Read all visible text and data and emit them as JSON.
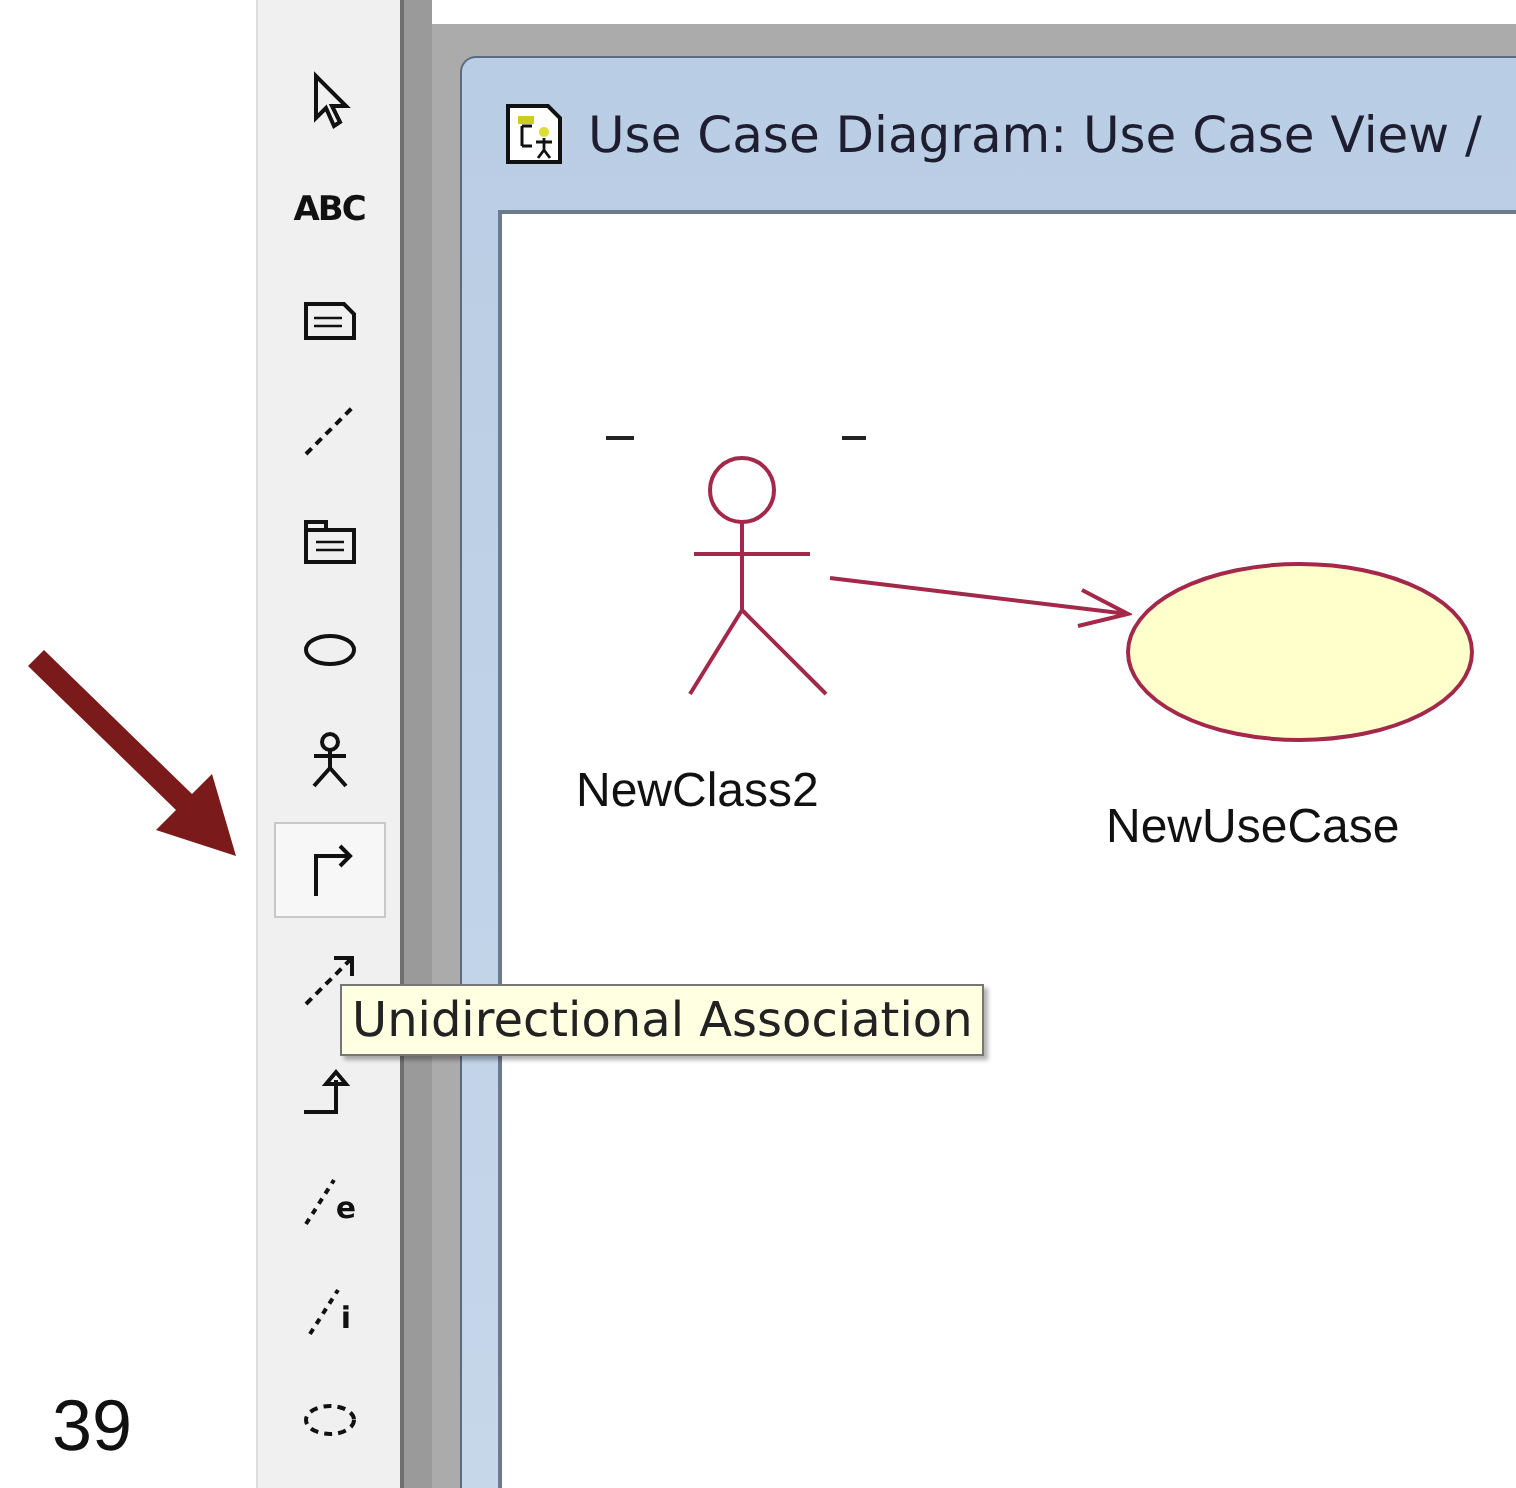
{
  "slide": {
    "page_number": "39"
  },
  "toolbox": {
    "tools": [
      {
        "kind": "pointer",
        "selected": false
      },
      {
        "kind": "text",
        "label": "ABC",
        "selected": false
      },
      {
        "kind": "note",
        "selected": false
      },
      {
        "kind": "anchor",
        "selected": false
      },
      {
        "kind": "package",
        "selected": false
      },
      {
        "kind": "usecase",
        "selected": false
      },
      {
        "kind": "actor",
        "selected": false
      },
      {
        "kind": "association",
        "selected": true
      },
      {
        "kind": "dependency",
        "selected": false
      },
      {
        "kind": "generalization",
        "selected": false
      },
      {
        "kind": "extend",
        "label": "e",
        "selected": false
      },
      {
        "kind": "include",
        "label": "i",
        "selected": false
      },
      {
        "kind": "boundary",
        "selected": false
      }
    ],
    "tooltip": "Unidirectional Association"
  },
  "window": {
    "title": "Use Case Diagram: Use Case View /"
  },
  "diagram": {
    "actor": {
      "name": "NewClass2"
    },
    "use_case": {
      "name": "NewUseCase"
    }
  }
}
